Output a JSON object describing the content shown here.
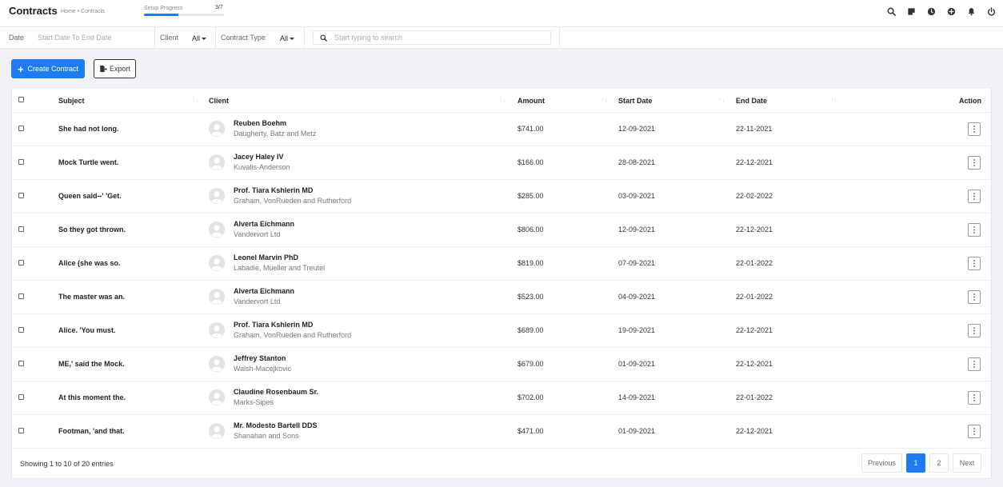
{
  "header": {
    "title": "Contracts",
    "breadcrumb": "Home • Contracts",
    "setup_label": "Setup Progress",
    "setup_count": "3/7",
    "setup_fraction": 0.43,
    "icons": [
      "search-icon",
      "notes-icon",
      "clock-icon",
      "plus-circle-icon",
      "bell-icon",
      "power-icon"
    ]
  },
  "filters": {
    "date_label": "Date",
    "date_placeholder": "Start Date To End Date",
    "client_label": "Client",
    "client_value": "All",
    "type_label": "Contract Type",
    "type_value": "All",
    "search_placeholder": "Start typing to search"
  },
  "actions": {
    "create_label": "Create Contract",
    "export_label": "Export"
  },
  "table": {
    "columns": {
      "subject": "Subject",
      "client": "Client",
      "amount": "Amount",
      "start": "Start Date",
      "end": "End Date",
      "action": "Action"
    },
    "rows": [
      {
        "subject": "She had not long.",
        "name": "Reuben Boehm",
        "company": "Daugherty, Batz and Metz",
        "amount": "$741.00",
        "start": "12-09-2021",
        "end": "22-11-2021"
      },
      {
        "subject": "Mock Turtle went.",
        "name": "Jacey Haley IV",
        "company": "Kuvalis-Anderson",
        "amount": "$166.00",
        "start": "28-08-2021",
        "end": "22-12-2021"
      },
      {
        "subject": "Queen said--' 'Get.",
        "name": "Prof. Tiara Kshlerin MD",
        "company": "Graham, VonRueden and Rutherford",
        "amount": "$285.00",
        "start": "03-09-2021",
        "end": "22-02-2022"
      },
      {
        "subject": "So they got thrown.",
        "name": "Alverta Eichmann",
        "company": "Vandervort Ltd",
        "amount": "$806.00",
        "start": "12-09-2021",
        "end": "22-12-2021"
      },
      {
        "subject": "Alice (she was so.",
        "name": "Leonel Marvin PhD",
        "company": "Labadie, Mueller and Treutel",
        "amount": "$819.00",
        "start": "07-09-2021",
        "end": "22-01-2022"
      },
      {
        "subject": "The master was an.",
        "name": "Alverta Eichmann",
        "company": "Vandervort Ltd",
        "amount": "$523.00",
        "start": "04-09-2021",
        "end": "22-01-2022"
      },
      {
        "subject": "Alice. 'You must.",
        "name": "Prof. Tiara Kshlerin MD",
        "company": "Graham, VonRueden and Rutherford",
        "amount": "$689.00",
        "start": "19-09-2021",
        "end": "22-12-2021"
      },
      {
        "subject": "ME,' said the Mock.",
        "name": "Jeffrey Stanton",
        "company": "Walsh-Macejkovic",
        "amount": "$679.00",
        "start": "01-09-2021",
        "end": "22-12-2021"
      },
      {
        "subject": "At this moment the.",
        "name": "Claudine Rosenbaum Sr.",
        "company": "Marks-Sipes",
        "amount": "$702.00",
        "start": "14-09-2021",
        "end": "22-01-2022"
      },
      {
        "subject": "Footman, 'and that.",
        "name": "Mr. Modesto Bartell DDS",
        "company": "Shanahan and Sons",
        "amount": "$471.00",
        "start": "01-09-2021",
        "end": "22-12-2021"
      }
    ]
  },
  "pagination": {
    "info": "Showing 1 to 10 of 20 entries",
    "previous": "Previous",
    "pages": [
      "1",
      "2"
    ],
    "active_page": "1",
    "next": "Next"
  },
  "colors": {
    "accent": "#1d7cf2",
    "background": "#f1f2f6"
  }
}
